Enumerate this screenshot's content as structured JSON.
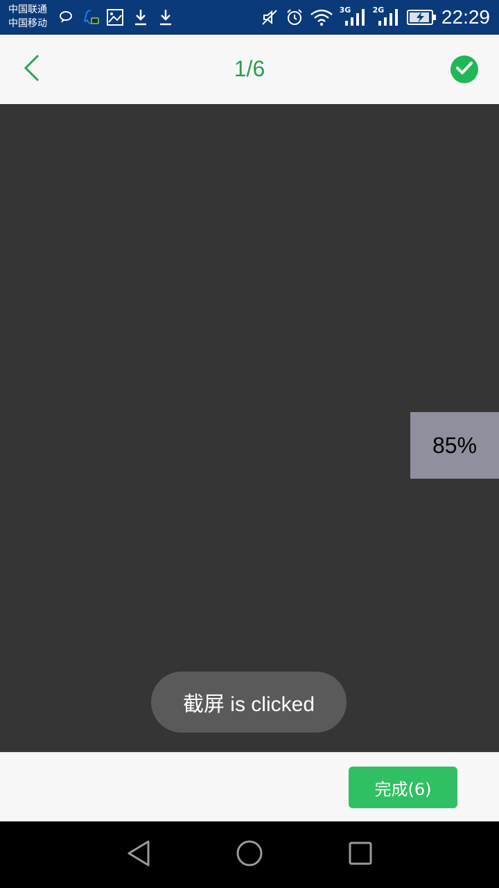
{
  "status_bar": {
    "carrier_1": "中国联通",
    "carrier_2": "中国移动",
    "network_1": "3G",
    "network_2": "2G",
    "time": "22:29",
    "icons": [
      "chat-bubble-icon",
      "qq-icon",
      "image-icon",
      "download-icon",
      "download-icon",
      "mute-icon",
      "alarm-icon",
      "wifi-icon",
      "signal-icon",
      "signal-icon",
      "battery-charging-icon"
    ]
  },
  "header": {
    "back_icon": "chevron-left-icon",
    "page_indicator": "1/6",
    "confirm_icon": "check-circle-icon",
    "accent_color": "#20b856"
  },
  "viewer": {
    "zoom_label": "85%"
  },
  "toast": {
    "message": "截屏 is clicked"
  },
  "footer": {
    "done_label": "完成(6)"
  },
  "nav_bar": {
    "icons": [
      "back-triangle-icon",
      "home-circle-icon",
      "recents-square-icon"
    ]
  }
}
